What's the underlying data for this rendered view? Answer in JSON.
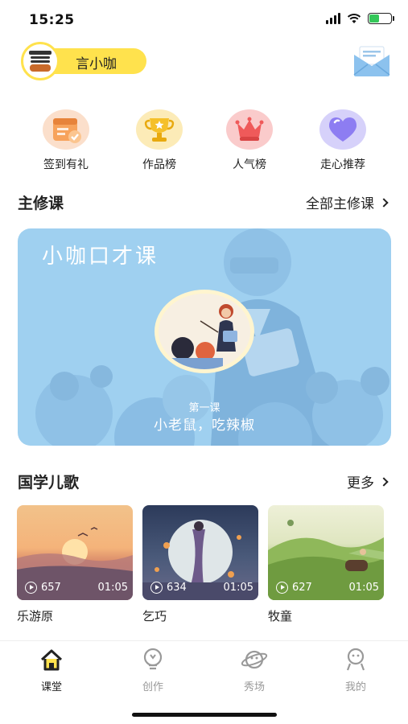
{
  "status": {
    "time": "15:25"
  },
  "header": {
    "username": "言小咖"
  },
  "quick_entries": [
    {
      "label": "签到有礼",
      "icon": "calendar-check-icon",
      "color": "#f4a26b"
    },
    {
      "label": "作品榜",
      "icon": "trophy-icon",
      "color": "#f5c730"
    },
    {
      "label": "人气榜",
      "icon": "crown-icon",
      "color": "#f06b6b"
    },
    {
      "label": "走心推荐",
      "icon": "heart-icon",
      "color": "#8a7cf0"
    }
  ],
  "main_course": {
    "section_title": "主修课",
    "more_label": "全部主修课",
    "card_title": "小咖口才课",
    "lesson_num": "第一课",
    "lesson_name": "小老鼠，吃辣椒"
  },
  "songs": {
    "section_title": "国学儿歌",
    "more_label": "更多",
    "items": [
      {
        "title": "乐游原",
        "plays": "657",
        "duration": "01:05"
      },
      {
        "title": "乞巧",
        "plays": "634",
        "duration": "01:05"
      },
      {
        "title": "牧童",
        "plays": "627",
        "duration": "01:05"
      }
    ]
  },
  "tabs": [
    {
      "label": "课堂",
      "icon": "home-icon",
      "active": true
    },
    {
      "label": "创作",
      "icon": "lightbulb-icon",
      "active": false
    },
    {
      "label": "秀场",
      "icon": "planet-icon",
      "active": false
    },
    {
      "label": "我的",
      "icon": "profile-icon",
      "active": false
    }
  ],
  "colors": {
    "accent_yellow": "#ffe24d",
    "card_blue": "#9fd0f0",
    "active_tab": "#222222",
    "inactive_tab": "#999999"
  }
}
